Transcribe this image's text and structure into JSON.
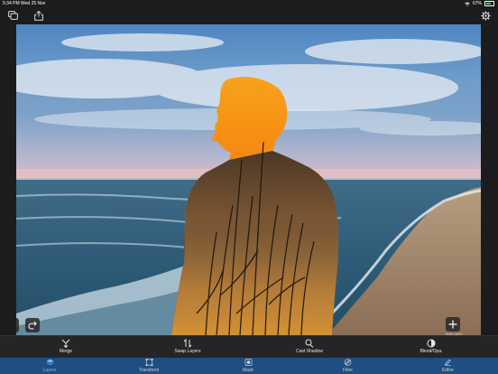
{
  "status": {
    "time": "5:34 PM",
    "date": "Wed 25 Nov",
    "battery": "67%",
    "battery_level": 0.67
  },
  "canvas_controls": {
    "add_layer_label": "Add Layer"
  },
  "actions": [
    {
      "label": "Merge",
      "icon": "merge-icon"
    },
    {
      "label": "Swap Layers",
      "icon": "swap-icon"
    },
    {
      "label": "Cast Shadow",
      "icon": "shadow-icon"
    },
    {
      "label": "Blend/Opa.",
      "icon": "blend-icon"
    }
  ],
  "tabs": [
    {
      "label": "Layers",
      "icon": "layers-icon",
      "active": true
    },
    {
      "label": "Transform",
      "icon": "transform-icon",
      "active": false
    },
    {
      "label": "Mask",
      "icon": "mask-icon",
      "active": false
    },
    {
      "label": "Filter",
      "icon": "filter-icon",
      "active": false
    },
    {
      "label": "Editor",
      "icon": "editor-icon",
      "active": false
    }
  ],
  "colors": {
    "accent": "#1f4e82",
    "accent_text": "#6fb6ff",
    "toolbar": "#252527",
    "tabbar": "#1a1a1c"
  }
}
